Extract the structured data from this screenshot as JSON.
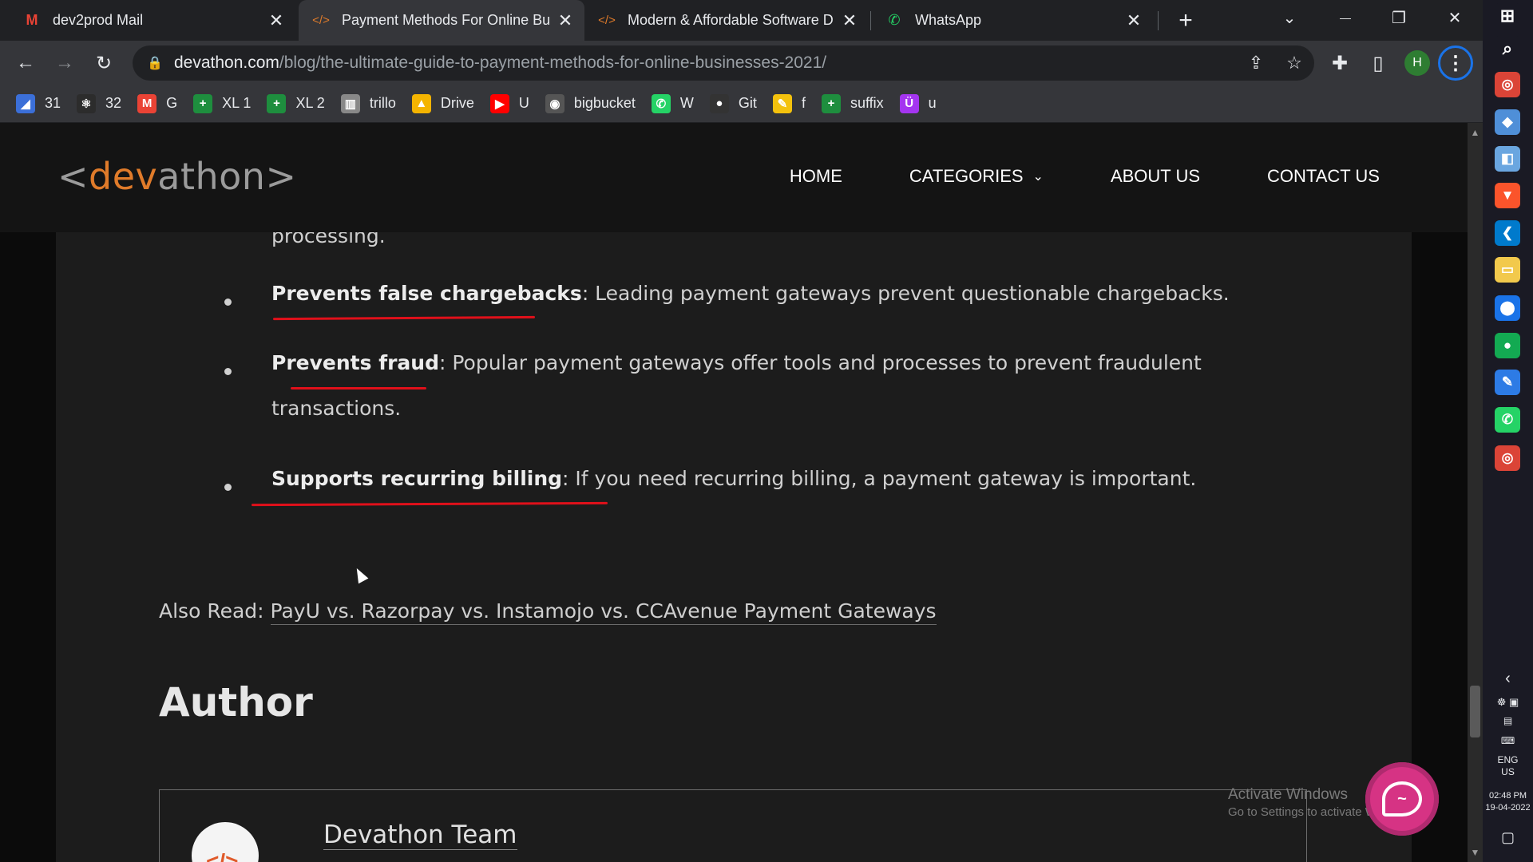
{
  "browser": {
    "tabs": [
      {
        "title": "dev2prod Mail",
        "icon": "gmail-icon",
        "icon_glyph": "M",
        "icon_color": "#ea4335"
      },
      {
        "title": "Payment Methods For Online Bu",
        "icon": "code-brackets-icon",
        "icon_glyph": "</>",
        "icon_color": "#e07b2a"
      },
      {
        "title": "Modern & Affordable Software D",
        "icon": "code-brackets-icon",
        "icon_glyph": "</>",
        "icon_color": "#e07b2a"
      },
      {
        "title": "WhatsApp",
        "icon": "whatsapp-icon",
        "icon_glyph": "✆",
        "icon_color": "#25d366"
      }
    ],
    "tab_close_glyph": "✕",
    "new_tab_glyph": "+",
    "window_controls": {
      "tab_search": "⌄",
      "minimize": "—",
      "restore": "❐",
      "close": "✕"
    },
    "toolbar": {
      "back": "←",
      "forward": "→",
      "reload": "↻",
      "share": "⇪",
      "star": "☆",
      "extensions": "✚",
      "sidepanel": "▯",
      "profile_initial": "H",
      "menu": "⋮"
    },
    "url": {
      "host": "devathon.com",
      "path": "/blog/the-ultimate-guide-to-payment-methods-for-online-businesses-2021/"
    },
    "bookmarks": [
      {
        "label": "31",
        "icon": "bookmark-31-icon",
        "glyph": "◢",
        "color": "#3b6fd8"
      },
      {
        "label": "32",
        "icon": "react-icon",
        "glyph": "⚛",
        "color": "#2c2c2c"
      },
      {
        "label": "G",
        "icon": "gmail-icon",
        "glyph": "M",
        "color": "#ea4335"
      },
      {
        "label": "XL 1",
        "icon": "sheets-icon",
        "glyph": "+",
        "color": "#1e8e3e"
      },
      {
        "label": "XL 2",
        "icon": "sheets-icon",
        "glyph": "+",
        "color": "#1e8e3e"
      },
      {
        "label": "trillo",
        "icon": "trello-icon",
        "glyph": "▥",
        "color": "#888"
      },
      {
        "label": "Drive",
        "icon": "drive-icon",
        "glyph": "▲",
        "color": "#f4b400"
      },
      {
        "label": "U",
        "icon": "youtube-icon",
        "glyph": "▶",
        "color": "#ff0000"
      },
      {
        "label": "bigbucket",
        "icon": "globe-icon",
        "glyph": "◉",
        "color": "#555"
      },
      {
        "label": "W",
        "icon": "whatsapp-icon",
        "glyph": "✆",
        "color": "#25d366"
      },
      {
        "label": "Git",
        "icon": "github-icon",
        "glyph": "●",
        "color": "#333"
      },
      {
        "label": "f",
        "icon": "file-icon",
        "glyph": "✎",
        "color": "#f4c20d"
      },
      {
        "label": "suffix",
        "icon": "sheets-icon",
        "glyph": "+",
        "color": "#1e8e3e"
      },
      {
        "label": "u",
        "icon": "udemy-icon",
        "glyph": "Ü",
        "color": "#a435f0"
      }
    ]
  },
  "site": {
    "logo": {
      "open": "<",
      "accent": "dev",
      "rest": "athon",
      "close": ">"
    },
    "nav": {
      "home": "HOME",
      "categories": "CATEGORIES",
      "categories_chevron": "⌄",
      "about": "ABOUT US",
      "contact": "CONTACT US"
    }
  },
  "article": {
    "continued_text": "processing.",
    "bullets": [
      {
        "bold": "Prevents false chargebacks",
        "text": ": Leading payment gateways prevent questionable chargebacks.",
        "text2": ""
      },
      {
        "bold": "Prevents fraud",
        "text": ": Popular payment gateways offer tools and processes to prevent fraudulent",
        "text2": "transactions."
      },
      {
        "bold": "Supports recurring billing",
        "text": ": If you need recurring billing, a payment gateway is important.",
        "text2": ""
      }
    ],
    "also_read": {
      "prefix": "Also Read: ",
      "link": "PayU vs. Razorpay vs. Instamojo vs. CCAvenue Payment Gateways"
    },
    "author_heading": "Author",
    "author_name": "Devathon Team",
    "author_logo_glyph": "</>"
  },
  "overlay": {
    "watermark_title": "Activate Windows",
    "watermark_sub": "Go to Settings to activate Windows.",
    "chat_glyph": "~"
  },
  "colors": {
    "annotation_red": "#e0101a",
    "brand_orange": "#e07b2a",
    "chat_pink": "#d63384"
  },
  "taskbar": {
    "apps": [
      {
        "name": "windows-start-icon",
        "glyph": "⊞",
        "color": "#1a1a24"
      },
      {
        "name": "search-icon",
        "glyph": "⌕",
        "color": "#1a1a24"
      },
      {
        "name": "chrome-icon",
        "glyph": "◎",
        "color": "#db4437"
      },
      {
        "name": "app-icon",
        "glyph": "◆",
        "color": "#4f8fd8"
      },
      {
        "name": "app-icon-2",
        "glyph": "◧",
        "color": "#6aa6e0"
      },
      {
        "name": "brave-icon",
        "glyph": "▼",
        "color": "#fb542b"
      },
      {
        "name": "vscode-icon",
        "glyph": "❮",
        "color": "#007acc"
      },
      {
        "name": "file-explorer-icon",
        "glyph": "▭",
        "color": "#f2c94c"
      },
      {
        "name": "maps-icon",
        "glyph": "⬤",
        "color": "#1a73e8"
      },
      {
        "name": "mongodb-icon",
        "glyph": "●",
        "color": "#13aa52"
      },
      {
        "name": "edit-icon",
        "glyph": "✎",
        "color": "#2d7be5"
      },
      {
        "name": "whatsapp-icon",
        "glyph": "✆",
        "color": "#25d366"
      },
      {
        "name": "chrome-profile-icon",
        "glyph": "◎",
        "color": "#db4437"
      }
    ],
    "language": "ENG",
    "region": "US",
    "time": "02:48 PM",
    "date": "19-04-2022",
    "tray_chevron": "‹",
    "notifications": "▢"
  }
}
